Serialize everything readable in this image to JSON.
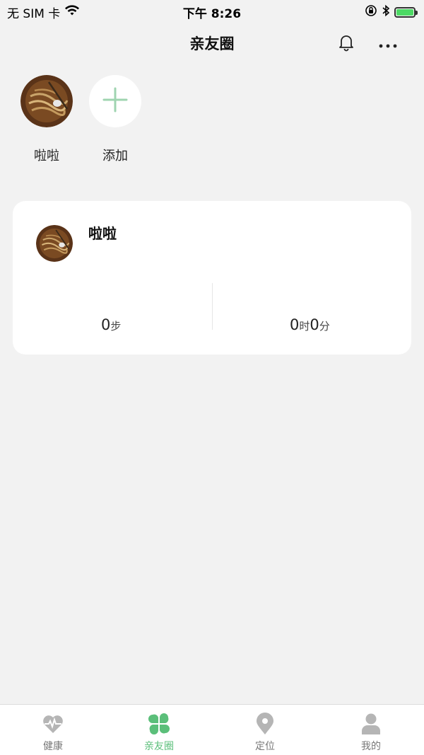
{
  "status_bar": {
    "carrier": "无 SIM 卡",
    "time": "下午 8:26"
  },
  "nav": {
    "title": "亲友圈",
    "bell_icon": "bell-icon",
    "more_icon": "more-icon"
  },
  "friends": [
    {
      "name": "啦啦",
      "avatar": "noodle-photo"
    }
  ],
  "add_label": "添加",
  "card": {
    "name": "啦啦",
    "steps_value": "0",
    "steps_unit": "步",
    "hours_value": "0",
    "hours_unit": "时",
    "minutes_value": "0",
    "minutes_unit": "分"
  },
  "tabs": [
    {
      "label": "健康",
      "icon": "heart-pulse-icon",
      "active": false
    },
    {
      "label": "亲友圈",
      "icon": "clover-icon",
      "active": true
    },
    {
      "label": "定位",
      "icon": "location-pin-icon",
      "active": false
    },
    {
      "label": "我的",
      "icon": "person-icon",
      "active": false
    }
  ],
  "colors": {
    "accent": "#5bbf7a",
    "background": "#f2f2f2",
    "card": "#ffffff",
    "inactive_tab": "#b5b5b5"
  }
}
